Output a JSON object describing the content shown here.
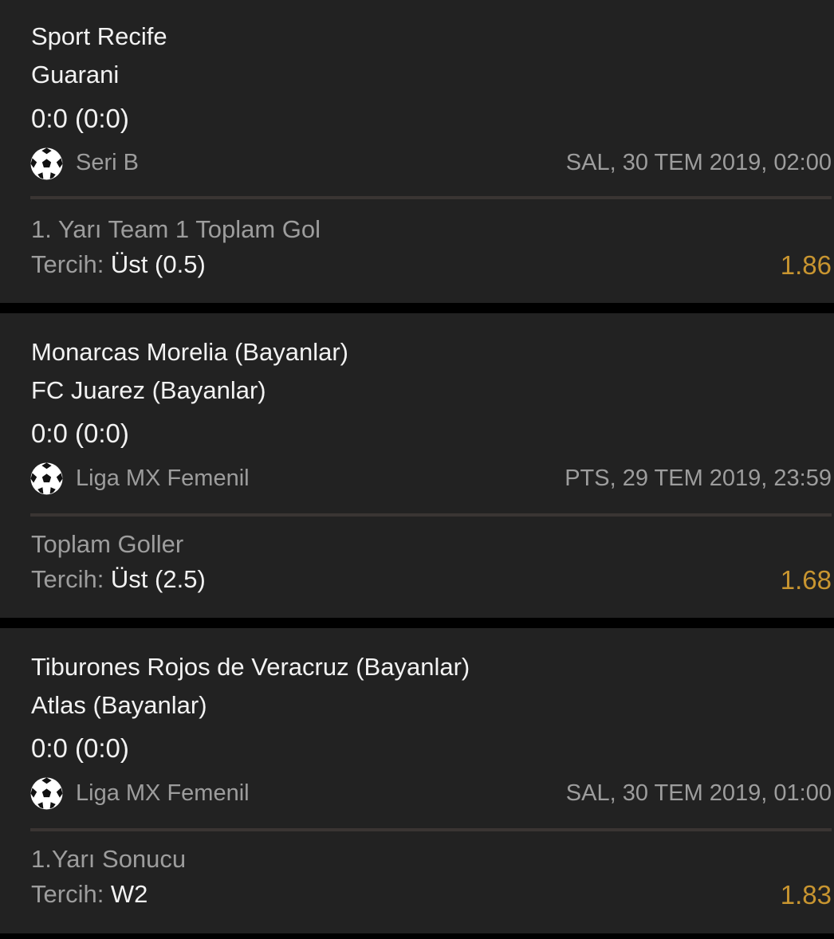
{
  "bets": [
    {
      "home_team": "Sport Recife",
      "away_team": "Guarani",
      "score": "0:0 (0:0)",
      "sport_icon": "soccer-ball-icon",
      "league": "Seri B",
      "datetime": "SAL, 30 TEM 2019, 02:00",
      "market": "1. Yarı Team 1 Toplam Gol",
      "pick_prefix": "Tercih: ",
      "pick": "Üst (0.5)",
      "odds": "1.86"
    },
    {
      "home_team": "Monarcas Morelia (Bayanlar)",
      "away_team": "FC Juarez (Bayanlar)",
      "score": "0:0 (0:0)",
      "sport_icon": "soccer-ball-icon",
      "league": "Liga MX Femenil",
      "datetime": "PTS, 29 TEM 2019, 23:59",
      "market": "Toplam Goller",
      "pick_prefix": "Tercih: ",
      "pick": "Üst (2.5)",
      "odds": "1.68"
    },
    {
      "home_team": "Tiburones Rojos de Veracruz (Bayanlar)",
      "away_team": "Atlas (Bayanlar)",
      "score": "0:0 (0:0)",
      "sport_icon": "soccer-ball-icon",
      "league": "Liga MX Femenil",
      "datetime": "SAL, 30 TEM 2019, 01:00",
      "market": "1.Yarı Sonucu",
      "pick_prefix": "Tercih: ",
      "pick": "W2",
      "odds": "1.83"
    }
  ],
  "colors": {
    "page_background": "#000000",
    "card_background": "#222222",
    "primary_text": "#f2f2f2",
    "secondary_text": "#9d9d9d",
    "odds": "#c89530",
    "divider": "#3a3533"
  }
}
